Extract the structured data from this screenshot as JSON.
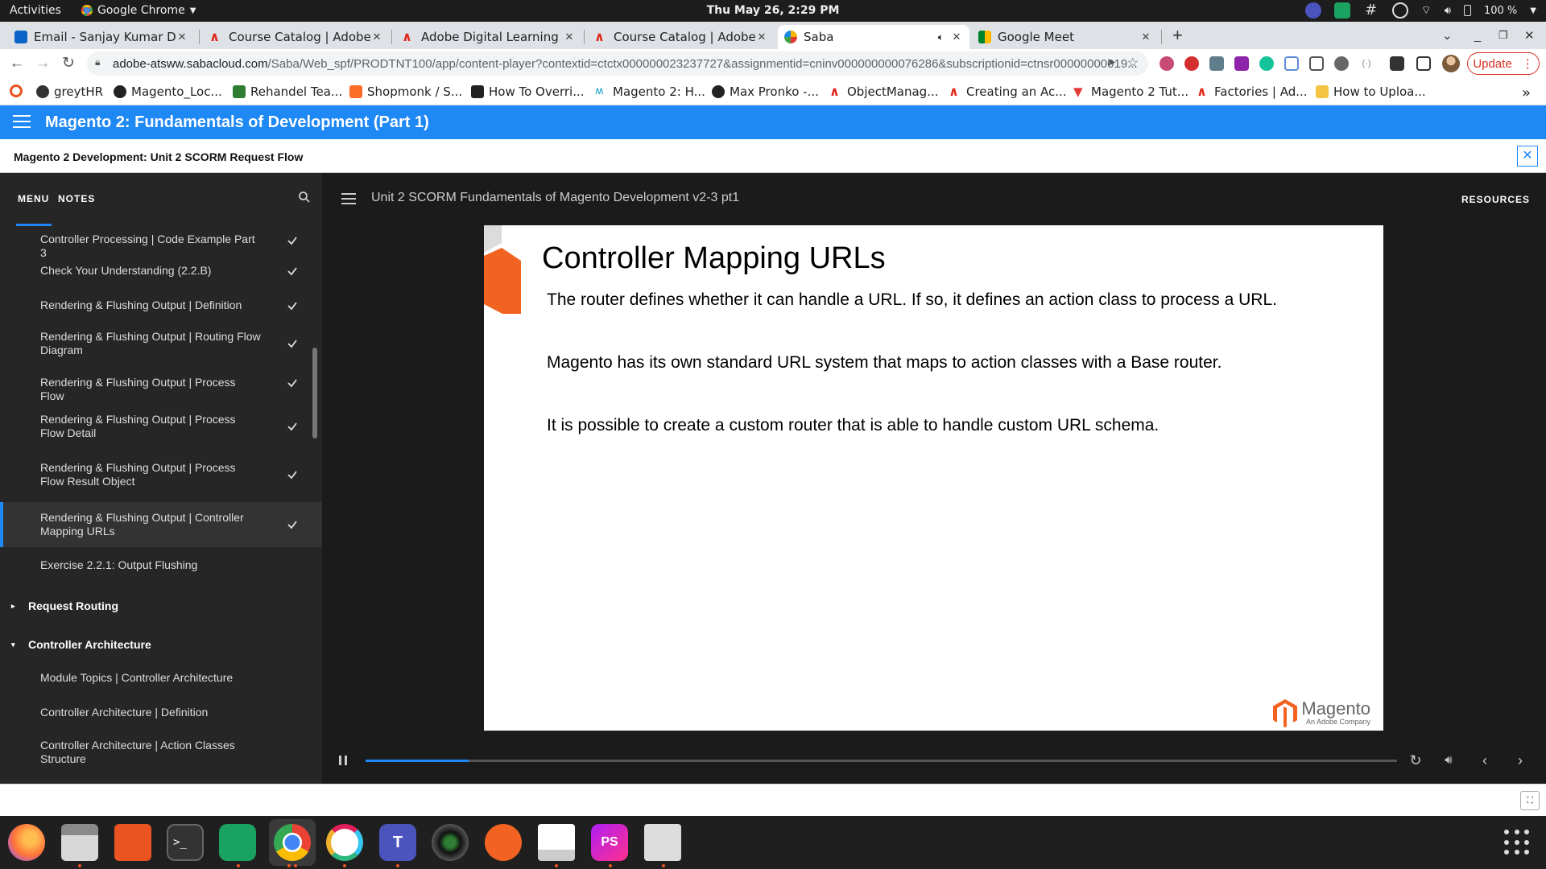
{
  "system": {
    "activities": "Activities",
    "app_name": "Google Chrome",
    "clock": "Thu May 26,  2:29 PM",
    "battery": "100 %"
  },
  "tabs": [
    {
      "title": "Email - Sanjay Kumar Das",
      "icon": "outlook-icon"
    },
    {
      "title": "Course Catalog | Adobe D",
      "icon": "adobe-icon"
    },
    {
      "title": "Adobe Digital Learning Se",
      "icon": "adobe-icon"
    },
    {
      "title": "Course Catalog | Adobe D",
      "icon": "adobe-icon"
    },
    {
      "title": "Saba",
      "icon": "saba-icon",
      "active": true
    },
    {
      "title": "Google Meet",
      "icon": "meet-icon"
    }
  ],
  "toolbar": {
    "url_host": "adobe-atsww.sabacloud.com",
    "url_path": "/Saba/Web_spf/PRODTNT100/app/content-player?contextid=ctctx000000023237727&assignmentid=cninv000000000076286&subscriptionid=ctnsr00000000019...",
    "update_label": "Update"
  },
  "bookmarks": [
    {
      "label": "",
      "icon": "opera-icon"
    },
    {
      "label": "greytHR",
      "icon": "greythr-icon"
    },
    {
      "label": "Magento_Loc...",
      "icon": "github-icon"
    },
    {
      "label": "Rehandel Tea...",
      "icon": "plus-icon"
    },
    {
      "label": "Shopmonk / S...",
      "icon": "gitlab-icon"
    },
    {
      "label": "How To Overri...",
      "icon": "page-icon"
    },
    {
      "label": "Magento 2: H...",
      "icon": "m-icon"
    },
    {
      "label": "Max Pronko -...",
      "icon": "mp-icon"
    },
    {
      "label": "ObjectManag...",
      "icon": "adobe-icon"
    },
    {
      "label": "Creating an Ac...",
      "icon": "adobe-icon"
    },
    {
      "label": "Magento 2 Tut...",
      "icon": "mageplaza-icon"
    },
    {
      "label": "Factories | Ad...",
      "icon": "adobe-icon"
    },
    {
      "label": "How to Uploa...",
      "icon": "bookmark-icon"
    }
  ],
  "app": {
    "title": "Magento 2: Fundamentals of Development (Part 1)",
    "subtitle": "Magento 2 Development: Unit 2 SCORM Request Flow"
  },
  "sidebar": {
    "tab_menu": "MENU",
    "tab_notes": "NOTES",
    "items": [
      {
        "label": "Controller Processing | Code Example Part 3",
        "done": true
      },
      {
        "label": "Check Your Understanding (2.2.B)",
        "done": true
      },
      {
        "label": "Rendering & Flushing Output | Definition",
        "done": true
      },
      {
        "label": "Rendering & Flushing Output | Routing Flow Diagram",
        "done": true
      },
      {
        "label": "Rendering & Flushing Output | Process Flow",
        "done": true
      },
      {
        "label": "Rendering & Flushing Output | Process Flow Detail",
        "done": true
      },
      {
        "label": "Rendering & Flushing Output | Process Flow Result Object",
        "done": true
      },
      {
        "label": "Rendering & Flushing Output | Controller Mapping URLs",
        "done": true,
        "selected": true
      },
      {
        "label": "Exercise 2.2.1: Output Flushing",
        "done": false
      }
    ],
    "sections": [
      {
        "label": "Request Routing",
        "expanded": false
      },
      {
        "label": "Controller Architecture",
        "expanded": true
      }
    ],
    "sub_items": [
      {
        "label": "Module Topics | Controller Architecture"
      },
      {
        "label": "Controller Architecture | Definition"
      },
      {
        "label": "Controller Architecture | Action Classes Structure"
      }
    ]
  },
  "content": {
    "title": "Unit 2 SCORM Fundamentals of Magento Development v2-3 pt1",
    "resources": "RESOURCES",
    "progress": 0.1
  },
  "slide": {
    "heading": "Controller Mapping URLs",
    "paragraphs": [
      "The router defines whether it can handle a URL. If so, it defines an action class to process a URL.",
      "Magento has its own standard URL system that maps to action classes with a Base router.",
      "It is possible to create a custom router that is able to handle custom URL schema."
    ],
    "logo_text": "Magento",
    "logo_sub": "An Adobe Company",
    "accent": "#f26322"
  },
  "colors": {
    "header_blue": "#1e88f5",
    "sidebar_bg": "#262626",
    "player_bg": "#1b1b1b"
  },
  "dock": [
    "firefox-icon",
    "files-icon",
    "software-icon",
    "terminal-icon",
    "chat-icon",
    "chrome-icon",
    "slack-icon",
    "teams-icon",
    "camera-icon",
    "inkscape-icon",
    "editor-icon",
    "phpstorm-icon",
    "screenshot-icon"
  ]
}
